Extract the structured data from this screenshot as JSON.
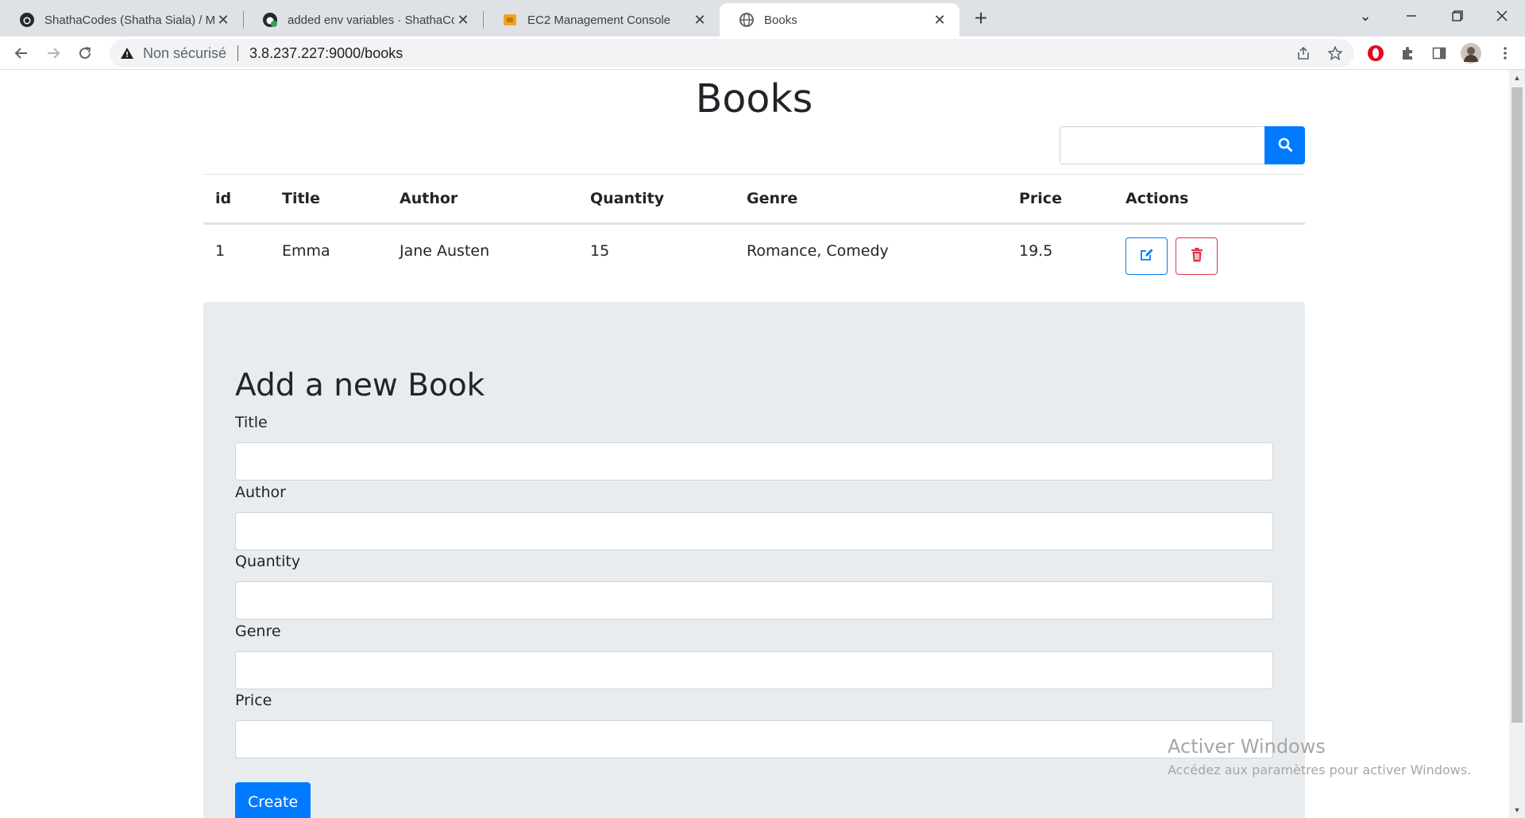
{
  "browser": {
    "tabs": [
      {
        "title": "ShathaCodes (Shatha Siala) / Ma",
        "icon": "github-icon"
      },
      {
        "title": "added env variables · ShathaCode",
        "icon": "github-check-icon"
      },
      {
        "title": "EC2 Management Console",
        "icon": "aws-icon"
      },
      {
        "title": "Books",
        "icon": "globe-icon",
        "active": true
      }
    ],
    "security_label": "Non sécurisé",
    "url": "3.8.237.227:9000/books"
  },
  "page": {
    "title": "Books",
    "search": {
      "placeholder": "",
      "value": ""
    },
    "table": {
      "columns": [
        "id",
        "Title",
        "Author",
        "Quantity",
        "Genre",
        "Price",
        "Actions"
      ],
      "rows": [
        {
          "id": "1",
          "title": "Emma",
          "author": "Jane Austen",
          "quantity": "15",
          "genre": "Romance, Comedy",
          "price": "19.5"
        }
      ]
    },
    "form": {
      "heading": "Add a new Book",
      "fields": [
        {
          "label": "Title",
          "value": ""
        },
        {
          "label": "Author",
          "value": ""
        },
        {
          "label": "Quantity",
          "value": ""
        },
        {
          "label": "Genre",
          "value": ""
        },
        {
          "label": "Price",
          "value": ""
        }
      ],
      "submit_label": "Create"
    }
  },
  "watermark": {
    "line1": "Activer Windows",
    "line2": "Accédez aux paramètres pour activer Windows."
  },
  "colors": {
    "primary": "#007bff",
    "danger": "#dc3545",
    "jumbotron": "#e9ecef"
  }
}
